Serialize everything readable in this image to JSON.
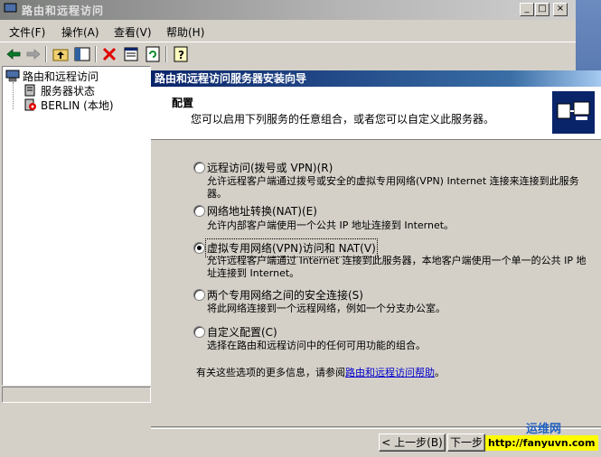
{
  "window": {
    "title": "路由和远程访问",
    "controls": {
      "minimize": "_",
      "maximize": "□",
      "close": "×"
    }
  },
  "menu": [
    {
      "label": "文件(F)"
    },
    {
      "label": "操作(A)"
    },
    {
      "label": "查看(V)"
    },
    {
      "label": "帮助(H)"
    }
  ],
  "toolbar": {
    "icons": [
      "back-arrow-icon",
      "forward-arrow-icon",
      "up-folder-icon",
      "show-tree-icon",
      "delete-icon",
      "properties-icon",
      "refresh-icon",
      "help-icon"
    ]
  },
  "tree": {
    "root": "路由和远程访问",
    "items": [
      "服务器状态",
      "BERLIN (本地)"
    ]
  },
  "wizard": {
    "title": "路由和远程访问服务器安装向导",
    "header_title": "配置",
    "header_subtitle": "您可以启用下列服务的任意组合，或者您可以自定义此服务器。",
    "options": [
      {
        "label": "远程访问(拨号或 VPN)(R)",
        "desc": "允许远程客户端通过拨号或安全的虚拟专用网络(VPN) Internet 连接来连接到此服务器。",
        "selected": false
      },
      {
        "label": "网络地址转换(NAT)(E)",
        "desc": "允许内部客户端使用一个公共 IP 地址连接到 Internet。",
        "selected": false
      },
      {
        "label": "虚拟专用网络(VPN)访问和 NAT(V)",
        "desc": "允许远程客户端通过 Internet 连接到此服务器，本地客户端使用一个单一的公共 IP 地址连接到 Internet。",
        "selected": true
      },
      {
        "label": "两个专用网络之间的安全连接(S)",
        "desc": "将此网络连接到一个远程网络，例如一个分支办公室。",
        "selected": false
      },
      {
        "label": "自定义配置(C)",
        "desc": "选择在路由和远程访问中的任何可用功能的组合。",
        "selected": false
      }
    ],
    "more_info_prefix": "有关这些选项的更多信息，请参阅",
    "help_link": "路由和远程访问帮助",
    "more_info_suffix": "。",
    "back_button": "< 上一步(B)",
    "next_button": "下一步"
  },
  "watermark": {
    "banner": "http://fanyuvn.com",
    "brand": "运维网"
  }
}
